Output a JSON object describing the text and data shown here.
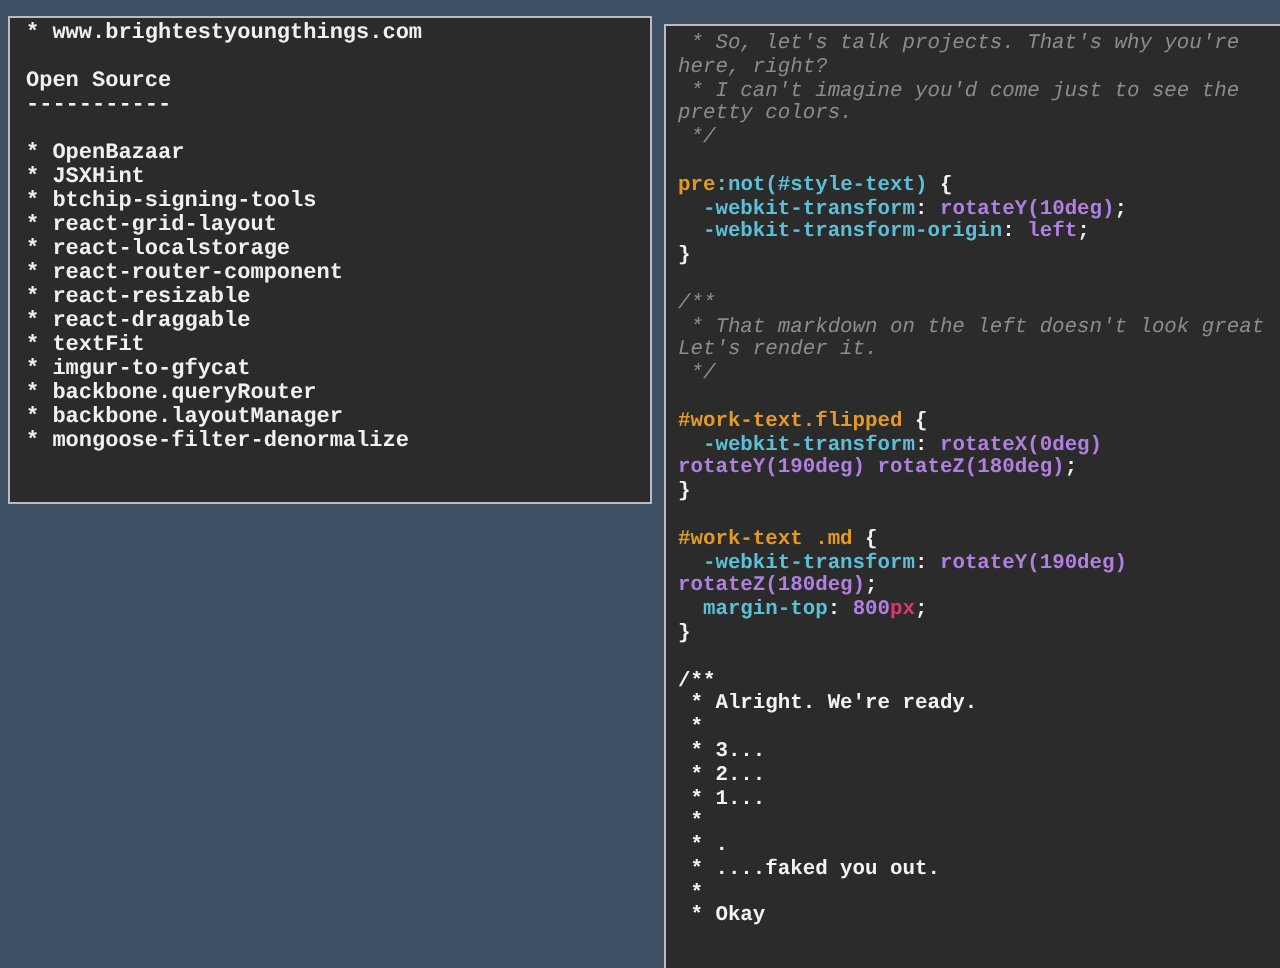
{
  "left_panel": {
    "blocks": [
      [
        "* www.brightestyoungthings.com"
      ],
      [
        "Open Source",
        "-----------"
      ],
      [
        "* OpenBazaar",
        "* JSXHint",
        "* btchip-signing-tools",
        "* react-grid-layout",
        "* react-localstorage",
        "* react-router-component",
        "* react-resizable",
        "* react-draggable",
        "* textFit",
        "* imgur-to-gfycat",
        "* backbone.queryRouter",
        "* backbone.layoutManager",
        "* mongoose-filter-denormalize"
      ]
    ]
  },
  "right_panel": {
    "blocks": [
      [
        {
          "tokens": [
            {
              "kind": "comment",
              "text": " * So, let's talk projects. That's why you're"
            }
          ]
        },
        {
          "tokens": [
            {
              "kind": "comment",
              "text": "here, right?"
            }
          ]
        },
        {
          "tokens": [
            {
              "kind": "comment",
              "text": " * I can't imagine you'd come just to see the"
            }
          ]
        },
        {
          "tokens": [
            {
              "kind": "comment",
              "text": "pretty colors."
            }
          ]
        },
        {
          "tokens": [
            {
              "kind": "comment",
              "text": " */"
            }
          ]
        }
      ],
      [
        {
          "tokens": [
            {
              "kind": "selector",
              "text": "pre"
            },
            {
              "kind": "property",
              "text": ":not(#style-text)"
            },
            {
              "kind": "plain",
              "text": " {"
            }
          ]
        },
        {
          "tokens": [
            {
              "kind": "property",
              "text": "  -webkit-transform"
            },
            {
              "kind": "plain",
              "text": ": "
            },
            {
              "kind": "value",
              "text": "rotateY(10deg)"
            },
            {
              "kind": "plain",
              "text": ";"
            }
          ]
        },
        {
          "tokens": [
            {
              "kind": "property",
              "text": "  -webkit-transform-origin"
            },
            {
              "kind": "plain",
              "text": ": "
            },
            {
              "kind": "value",
              "text": "left"
            },
            {
              "kind": "plain",
              "text": ";"
            }
          ]
        },
        {
          "tokens": [
            {
              "kind": "plain",
              "text": "}"
            }
          ]
        }
      ],
      [
        {
          "tokens": [
            {
              "kind": "comment",
              "text": "/**"
            }
          ]
        },
        {
          "tokens": [
            {
              "kind": "comment",
              "text": " * That markdown on the left doesn't look great"
            }
          ]
        },
        {
          "tokens": [
            {
              "kind": "comment",
              "text": "Let's render it."
            }
          ]
        },
        {
          "tokens": [
            {
              "kind": "comment",
              "text": " */"
            }
          ]
        }
      ],
      [
        {
          "tokens": [
            {
              "kind": "selector",
              "text": "#work-text.flipped"
            },
            {
              "kind": "plain",
              "text": " {"
            }
          ]
        },
        {
          "tokens": [
            {
              "kind": "property",
              "text": "  -webkit-transform"
            },
            {
              "kind": "plain",
              "text": ": "
            },
            {
              "kind": "value",
              "text": "rotateX(0deg)"
            }
          ]
        },
        {
          "tokens": [
            {
              "kind": "value",
              "text": "rotateY(190deg) rotateZ(180deg)"
            },
            {
              "kind": "plain",
              "text": ";"
            }
          ]
        },
        {
          "tokens": [
            {
              "kind": "plain",
              "text": "}"
            }
          ]
        }
      ],
      [
        {
          "tokens": [
            {
              "kind": "selector",
              "text": "#work-text .md"
            },
            {
              "kind": "plain",
              "text": " {"
            }
          ]
        },
        {
          "tokens": [
            {
              "kind": "property",
              "text": "  -webkit-transform"
            },
            {
              "kind": "plain",
              "text": ": "
            },
            {
              "kind": "value",
              "text": "rotateY(190deg)"
            }
          ]
        },
        {
          "tokens": [
            {
              "kind": "value",
              "text": "rotateZ(180deg)"
            },
            {
              "kind": "plain",
              "text": ";"
            }
          ]
        },
        {
          "tokens": [
            {
              "kind": "property",
              "text": "  margin-top"
            },
            {
              "kind": "plain",
              "text": ": "
            },
            {
              "kind": "value",
              "text": "800"
            },
            {
              "kind": "unit",
              "text": "px"
            },
            {
              "kind": "plain",
              "text": ";"
            }
          ]
        },
        {
          "tokens": [
            {
              "kind": "plain",
              "text": "}"
            }
          ]
        }
      ],
      [
        {
          "tokens": [
            {
              "kind": "plain",
              "text": "/**"
            }
          ]
        },
        {
          "tokens": [
            {
              "kind": "plain",
              "text": " * Alright. We're ready."
            }
          ]
        },
        {
          "tokens": [
            {
              "kind": "plain",
              "text": " *"
            }
          ]
        },
        {
          "tokens": [
            {
              "kind": "plain",
              "text": " * 3..."
            }
          ]
        },
        {
          "tokens": [
            {
              "kind": "plain",
              "text": " * 2..."
            }
          ]
        },
        {
          "tokens": [
            {
              "kind": "plain",
              "text": " * 1..."
            }
          ]
        },
        {
          "tokens": [
            {
              "kind": "plain",
              "text": " *"
            }
          ]
        },
        {
          "tokens": [
            {
              "kind": "plain",
              "text": " * ."
            }
          ]
        },
        {
          "tokens": [
            {
              "kind": "plain",
              "text": " * ....faked you out."
            }
          ]
        },
        {
          "tokens": [
            {
              "kind": "plain",
              "text": " *"
            }
          ]
        },
        {
          "tokens": [
            {
              "kind": "plain",
              "text": " * Okay"
            }
          ]
        }
      ]
    ]
  }
}
